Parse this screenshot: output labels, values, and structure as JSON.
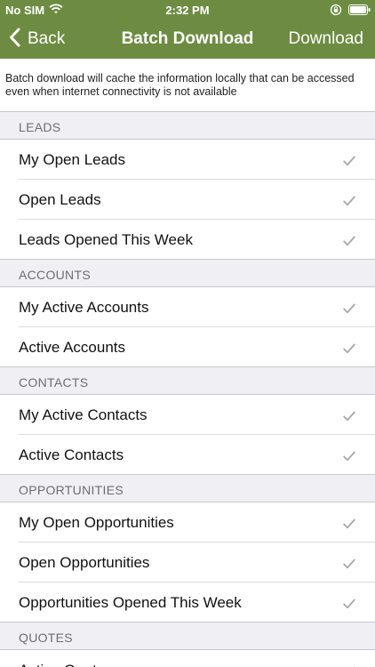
{
  "status_bar": {
    "carrier": "No SIM",
    "time": "2:32 PM",
    "icons": [
      "wifi-icon",
      "orientation-lock-icon",
      "battery-icon"
    ]
  },
  "nav": {
    "back_label": "Back",
    "title": "Batch Download",
    "action_label": "Download",
    "back_icon": "chevron-left-icon"
  },
  "info_text": "Batch download will cache the information locally that can be accessed even when internet connectivity is not available",
  "sections": [
    {
      "header": "LEADS",
      "items": [
        {
          "label": "My Open Leads",
          "checked": true
        },
        {
          "label": "Open Leads",
          "checked": true
        },
        {
          "label": "Leads Opened This Week",
          "checked": true
        }
      ]
    },
    {
      "header": "ACCOUNTS",
      "items": [
        {
          "label": "My Active Accounts",
          "checked": true
        },
        {
          "label": "Active Accounts",
          "checked": true
        }
      ]
    },
    {
      "header": "CONTACTS",
      "items": [
        {
          "label": "My Active Contacts",
          "checked": true
        },
        {
          "label": "Active Contacts",
          "checked": true
        }
      ]
    },
    {
      "header": "OPPORTUNITIES",
      "items": [
        {
          "label": "My Open Opportunities",
          "checked": true
        },
        {
          "label": "Open Opportunities",
          "checked": true
        },
        {
          "label": "Opportunities Opened This Week",
          "checked": true
        }
      ]
    },
    {
      "header": "QUOTES",
      "items": [
        {
          "label": "Active Quotes",
          "checked": true
        }
      ]
    }
  ],
  "colors": {
    "header_bg": "#6d8c42",
    "header_text": "#ffffff",
    "section_bg": "#efeff4",
    "section_text": "#6d6d72",
    "checkmark": "#a7a7ab"
  }
}
